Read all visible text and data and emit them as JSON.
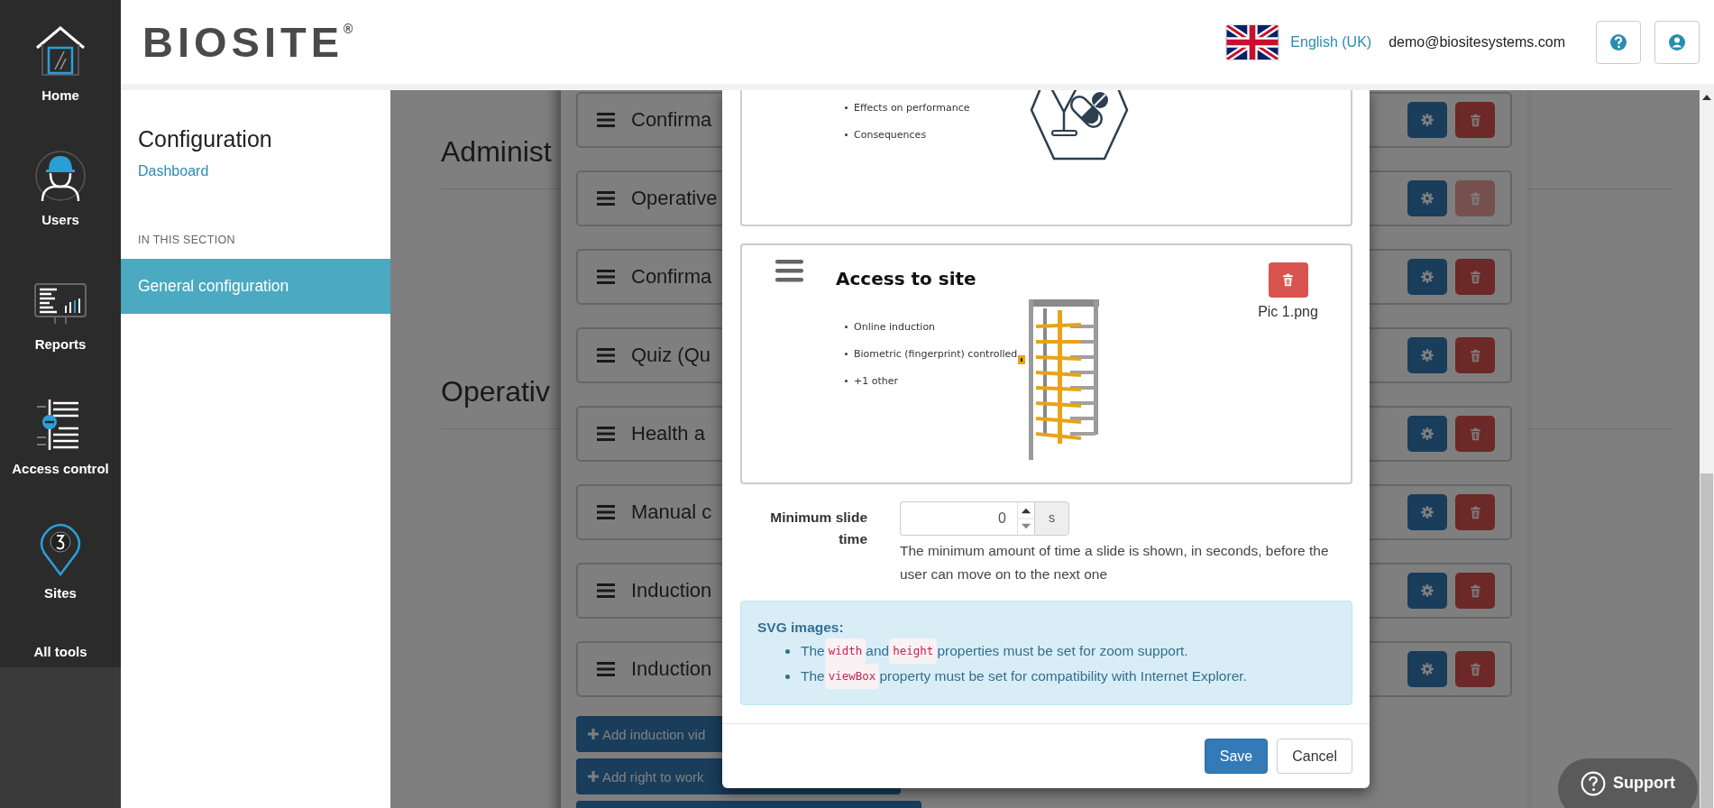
{
  "nav": [
    {
      "label": "Home",
      "kind": "home"
    },
    {
      "label": "Users",
      "kind": "user"
    },
    {
      "label": "Reports",
      "kind": "reports"
    },
    {
      "label": "Access control",
      "kind": "access"
    },
    {
      "label": "Sites",
      "kind": "sites"
    },
    {
      "label": "All tools"
    }
  ],
  "header": {
    "logo": "BIOSITE$^{®}$",
    "language": "English (UK)",
    "email": "demo@biositesystems.com"
  },
  "sidebar": {
    "title": "Configuration",
    "link": "Dashboard",
    "section_label": "IN THIS SECTION",
    "items": [
      {
        "label": "General configuration",
        "selected": true
      }
    ]
  },
  "background": {
    "headings": [
      "Administ",
      "Operativ"
    ],
    "rows": [
      {
        "label": "Confirma",
        "delete_disabled": false
      },
      {
        "label": "Operative",
        "delete_disabled": true
      },
      {
        "label": "Confirma",
        "delete_disabled": false
      },
      {
        "label": "Quiz (Qu",
        "delete_disabled": false
      },
      {
        "label": "Health a",
        "delete_disabled": false
      },
      {
        "label": "Manual c",
        "delete_disabled": false
      },
      {
        "label": "Induction",
        "delete_disabled": false
      },
      {
        "label": "Induction",
        "delete_disabled": false
      }
    ],
    "add_buttons": [
      "Add induction vid",
      "Add right to work"
    ]
  },
  "modal": {
    "slides": [
      {
        "cut_off": true,
        "bullets": [
          "Effects on performance",
          "Consequences"
        ],
        "kind": "hexagon"
      },
      {
        "cut_off": false,
        "title": "Access to site",
        "bullets": [
          "Online induction",
          "Biometric (fingerprint) controlled",
          "+1 other"
        ],
        "kind": "turnstile",
        "file": "Pic 1.png"
      }
    ],
    "min_time": {
      "label": "Minimum slide time",
      "value": "0",
      "unit": "s",
      "help": "The minimum amount of time a slide is shown, in seconds, before the user can move on to the next one"
    },
    "info": {
      "title": "SVG images:",
      "items": [
        [
          {
            "kind": "text",
            "text": "The"
          },
          {
            "kind": "code",
            "text": "width"
          },
          {
            "kind": "text",
            "text": "and"
          },
          {
            "kind": "code",
            "text": "height"
          },
          {
            "kind": "text",
            "text": "properties must be set for zoom support."
          }
        ],
        [
          {
            "kind": "text",
            "text": "The"
          },
          {
            "kind": "code",
            "text": "viewBox"
          },
          {
            "kind": "text",
            "text": "property must be set for compatibility with Internet Explorer."
          }
        ]
      ]
    },
    "buttons": [
      {
        "label": "Save",
        "kind": "primary"
      },
      {
        "label": "Cancel",
        "kind": "default"
      }
    ]
  },
  "support": "Support"
}
